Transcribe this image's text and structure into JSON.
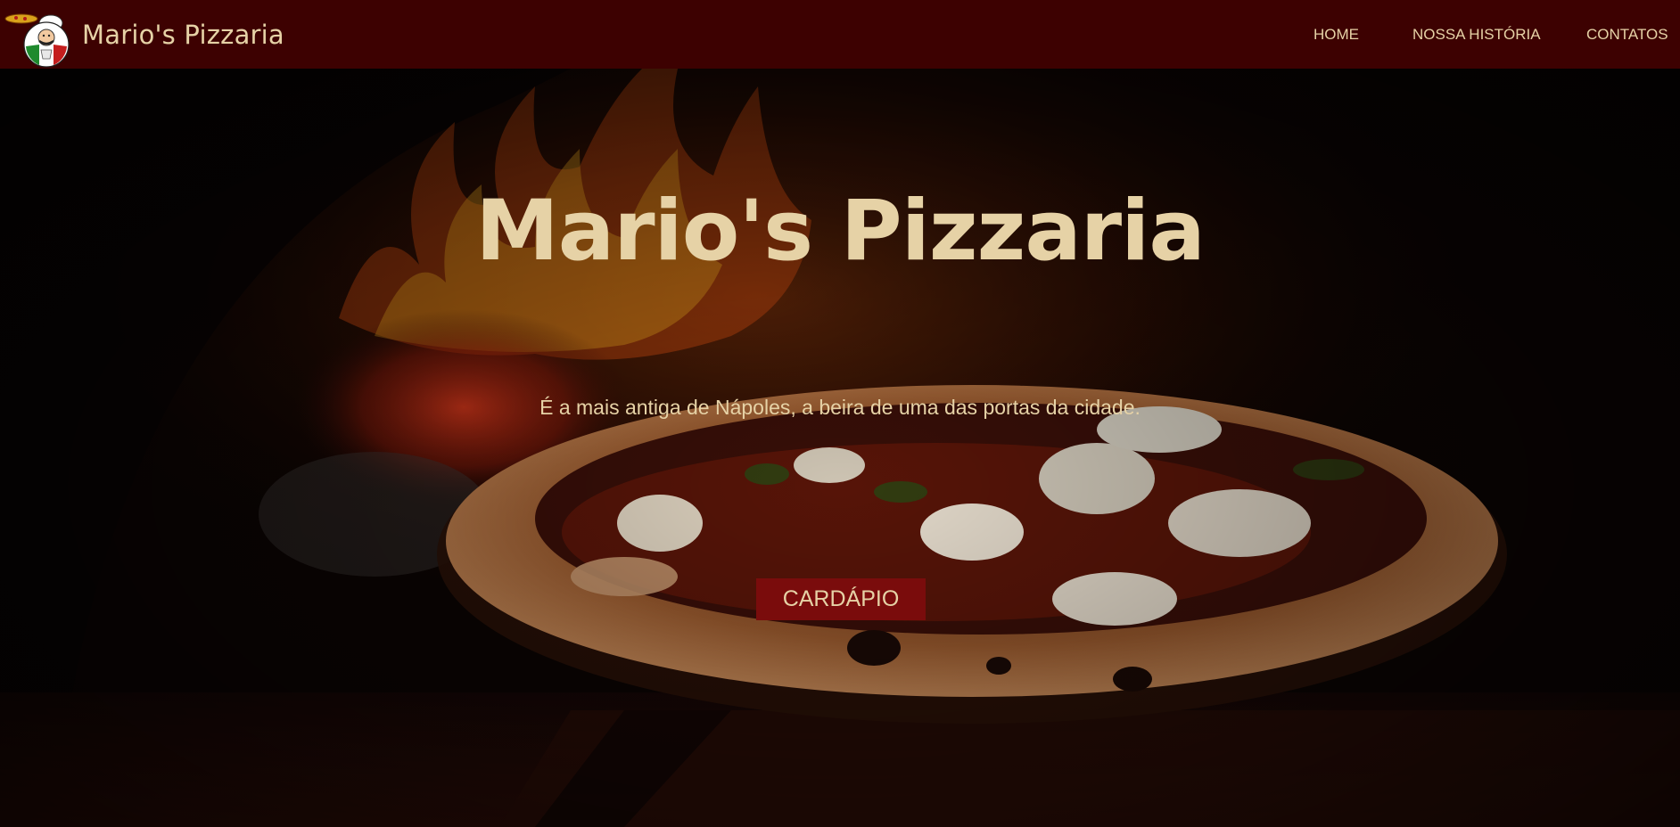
{
  "brand": {
    "name": "Mario's Pizzaria",
    "logo_icon": "chef-with-pizza-logo"
  },
  "nav": {
    "items": [
      {
        "label": "HOME"
      },
      {
        "label": "NOSSA HISTÓRIA"
      },
      {
        "label": "CONTATOS"
      }
    ]
  },
  "hero": {
    "title": "Mario's Pizzaria",
    "subtitle": "É a mais antiga de Nápoles, a beira de uma das portas da cidade.",
    "cta_label": "CARDÁPIO",
    "background_image": "pizza-in-wood-fired-oven-photo"
  },
  "colors": {
    "navbar_bg": "#3d0101",
    "text_cream": "#e6d2a6",
    "button_bg": "#7a0c0c"
  }
}
